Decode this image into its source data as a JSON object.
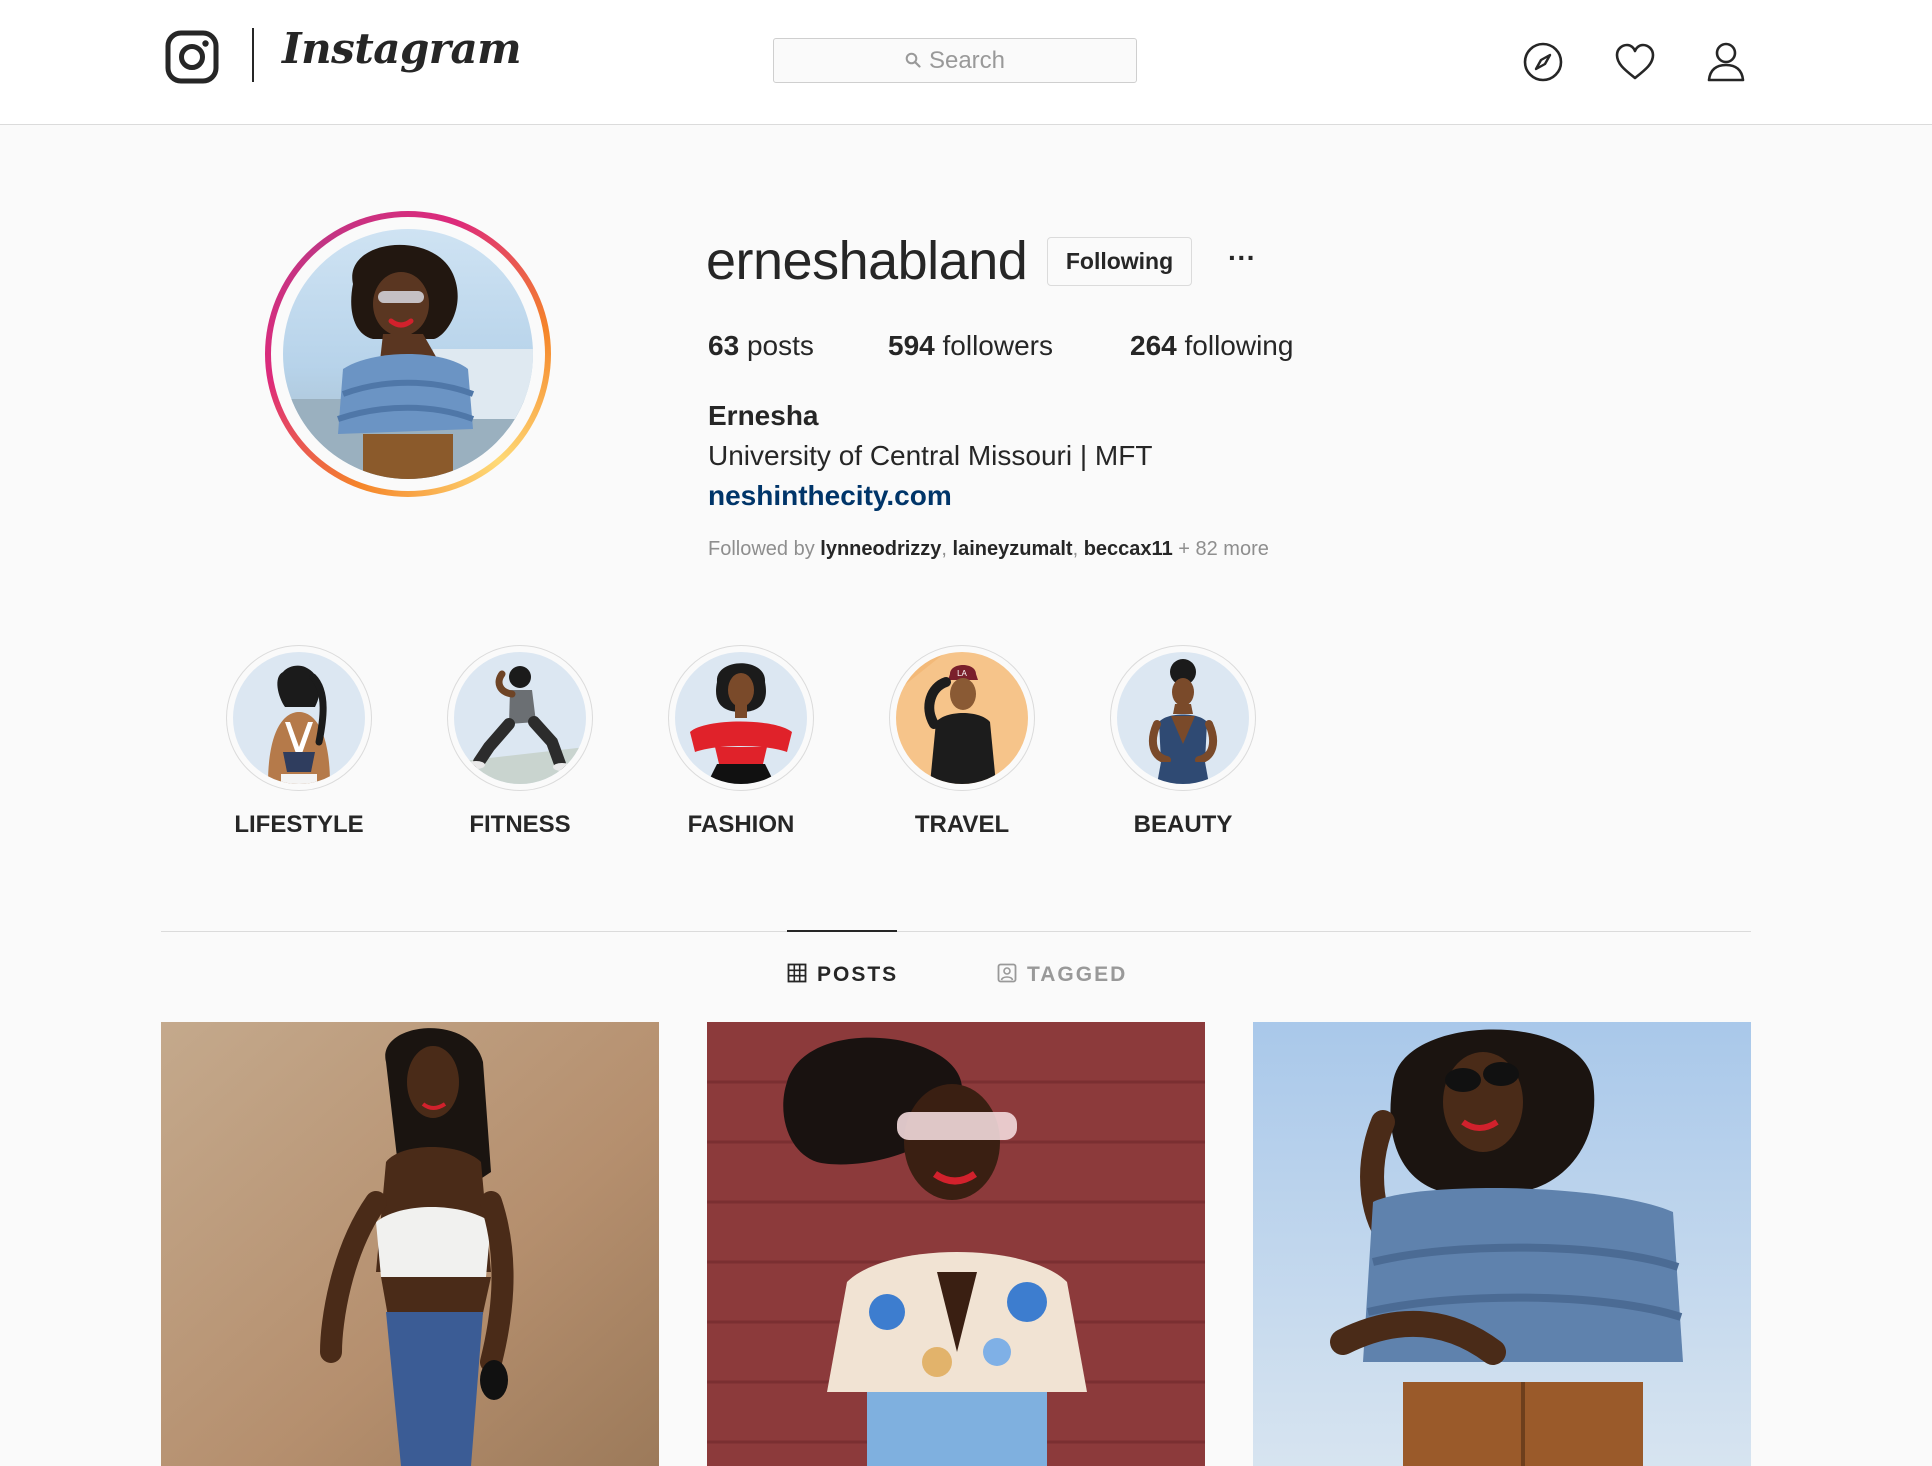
{
  "nav": {
    "wordmark": "Instagram",
    "search_placeholder": "Search",
    "icons": [
      "instagram-logo-icon",
      "search-icon",
      "explore-compass-icon",
      "activity-heart-icon",
      "profile-person-icon"
    ]
  },
  "profile": {
    "username": "erneshabland",
    "follow_button": "Following",
    "more_button": "···",
    "posts_count": "63",
    "posts_label": "posts",
    "followers_count": "594",
    "followers_label": "followers",
    "following_count": "264",
    "following_label": "following",
    "full_name": "Ernesha",
    "bio": "University of Central Missouri | MFT",
    "website": "neshinthecity.com",
    "followed_by_prefix": "Followed by ",
    "followed_by": [
      "lynneodrizzy",
      "laineyzumalt",
      "beccax11"
    ],
    "followed_by_suffix": " + 82 more"
  },
  "highlights": [
    {
      "label": "LIFESTYLE"
    },
    {
      "label": "FITNESS"
    },
    {
      "label": "FASHION"
    },
    {
      "label": "TRAVEL"
    },
    {
      "label": "BEAUTY"
    }
  ],
  "tabs": {
    "posts": "POSTS",
    "tagged": "TAGGED",
    "active": "POSTS"
  },
  "colors": {
    "link": "#003569",
    "muted": "#8e8e8e",
    "text": "#262626",
    "border": "#dbdbdb",
    "ring_start": "#f58529",
    "ring_end": "#dd2a7b"
  }
}
